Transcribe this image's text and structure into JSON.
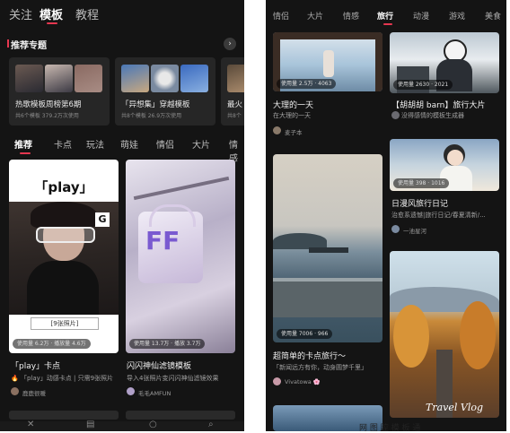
{
  "left": {
    "top_tabs": [
      "关注",
      "模板",
      "教程"
    ],
    "section_title": "推荐专题",
    "section_more_icon": "chevron-right-icon",
    "topics": [
      {
        "name": "热歌模板周榜第6期",
        "meta": "共6个模板 379.2万次使用"
      },
      {
        "name": "「异想集」穿越模板",
        "meta": "共8个模板 26.9万次使用"
      },
      {
        "name": "最火",
        "meta": "共8个"
      }
    ],
    "category_tabs": [
      "推荐",
      "卡点",
      "玩法",
      "萌娃",
      "情侣",
      "大片",
      "情感"
    ],
    "cards": [
      {
        "overlay": "「play」",
        "caption": "[9张照片]",
        "stats": "使用量 6.2万 · 播放量 4.6万",
        "title": "「play」卡点",
        "subtitle": "🔥 「play」动感卡点 | 只需9张照片",
        "user": "鹿鹿很暖"
      },
      {
        "overlay": "FF",
        "caption": "",
        "stats": "使用量 13.7万 · 播放 3.7万",
        "title": "闪闪神仙滤镜模板",
        "subtitle": "导入4张照片变闪闪神仙滤镜效果",
        "user": "毛毛AMFUN"
      }
    ],
    "bottom_icons": [
      "close-icon",
      "film-icon",
      "circle-icon",
      "search-icon"
    ]
  },
  "right": {
    "tabs": [
      "情侣",
      "大片",
      "情感",
      "旅行",
      "动漫",
      "游戏",
      "美食"
    ],
    "active_tab": "旅行",
    "cards": [
      {
        "stats": "使用量 2.5万 · 4063",
        "title": "大理的一天",
        "subtitle": "在大理的一天",
        "user": "麦子本"
      },
      {
        "stats": "使用量 2630 · 2021",
        "title": "【胡胡胡 barn】旅行大片",
        "subtitle": "没得感情的模板生成器",
        "user": ""
      },
      {
        "stats": "使用量 398 · 1016",
        "title": "日漫风旅行日记",
        "subtitle": "治愈系遗憾|旅行日记/春夏清新/...",
        "user": "一池星河"
      },
      {
        "stats": "使用量 7006 · 966",
        "title": "超简单的卡点旅行～",
        "subtitle": "「新闻远方有你，动身圆梦千里」",
        "user": "Vivatowa 🌸"
      },
      {
        "stats": "",
        "title": "",
        "subtitle": "",
        "user": "",
        "overlay": "Travel Vlog"
      }
    ],
    "bottom_text": "网 图 腔 模 板 通"
  }
}
